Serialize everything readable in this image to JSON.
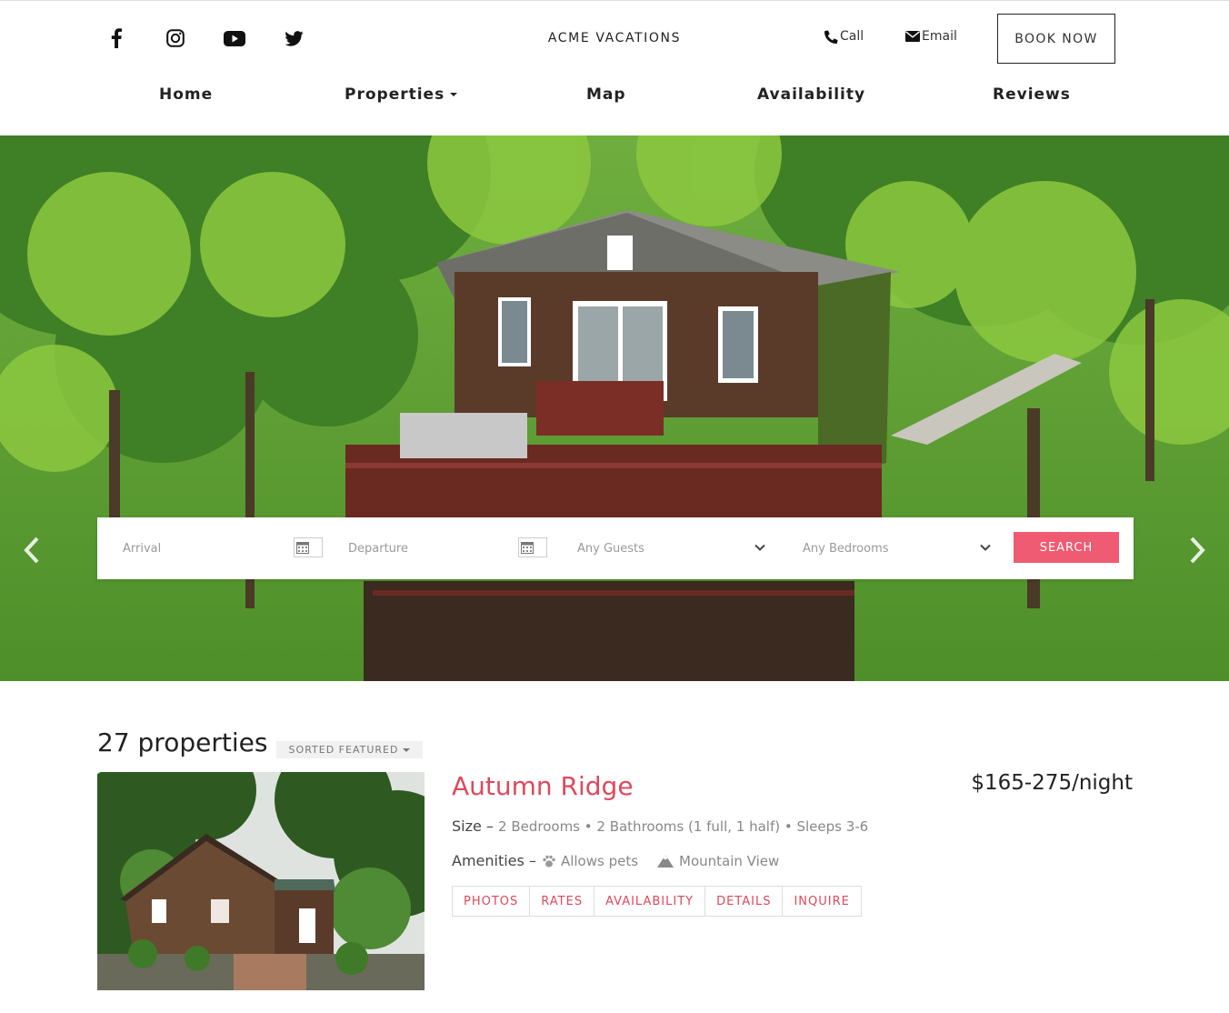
{
  "header": {
    "social": [
      "facebook-icon",
      "instagram-icon",
      "youtube-icon",
      "twitter-icon"
    ],
    "brand": "ACME VACATIONS",
    "call_label": "Call",
    "email_label": "Email",
    "book_label": "BOOK NOW"
  },
  "nav": {
    "items": [
      {
        "label": "Home",
        "has_caret": false
      },
      {
        "label": "Properties",
        "has_caret": true
      },
      {
        "label": "Map",
        "has_caret": false
      },
      {
        "label": "Availability",
        "has_caret": false
      },
      {
        "label": "Reviews",
        "has_caret": false
      }
    ]
  },
  "search": {
    "arrival_placeholder": "Arrival",
    "departure_placeholder": "Departure",
    "guests_value": "Any Guests",
    "bedrooms_value": "Any Bedrooms",
    "search_label": "SEARCH"
  },
  "listing": {
    "count": "27 properties",
    "sort_label": "SORTED FEATURED",
    "property": {
      "title": "Autumn Ridge",
      "price": "$165-275/night",
      "size_label": "Size –",
      "size_value": "2 Bedrooms • 2 Bathrooms (1 full, 1 half) • Sleeps 3-6",
      "amenities_label": "Amenities –",
      "amenities": [
        "Allows pets",
        "Mountain View"
      ],
      "actions": [
        "PHOTOS",
        "RATES",
        "AVAILABILITY",
        "DETAILS",
        "INQUIRE"
      ]
    }
  },
  "colors": {
    "accent": "#e0485c",
    "search_button": "#ef5b73"
  }
}
